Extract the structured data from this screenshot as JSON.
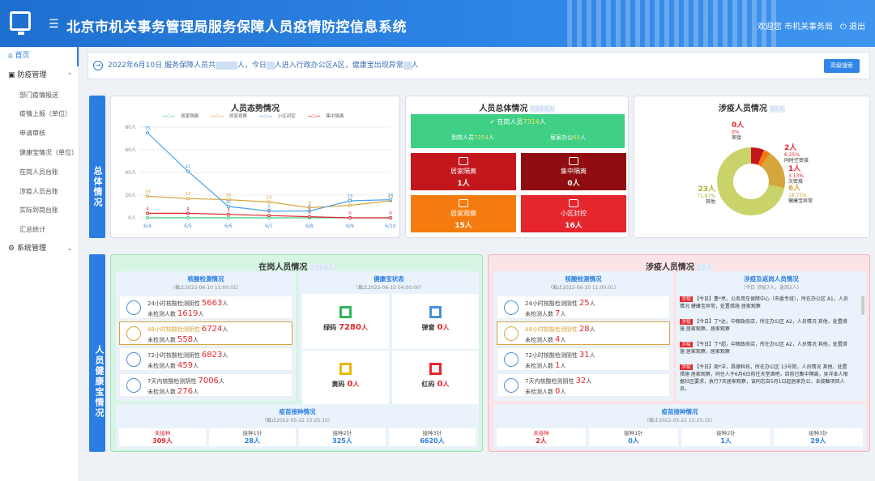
{
  "header": {
    "title": "北京市机关事务管理局服务保障人员疫情防控信息系统",
    "user": "欢迎您 市机关事务局",
    "logout": "退出"
  },
  "sidebar": {
    "items": [
      {
        "label": "首页",
        "top": true
      },
      {
        "label": "防疫管理",
        "top": true
      },
      {
        "label": "部门疫情报送"
      },
      {
        "label": "疫情上报（单位）"
      },
      {
        "label": "申请审核"
      },
      {
        "label": "健康宝情况（单位）"
      },
      {
        "label": "在岗人员台账"
      },
      {
        "label": "涉疫人员台账"
      },
      {
        "label": "实际到岗台账"
      },
      {
        "label": "汇总统计"
      },
      {
        "label": "系统管理",
        "top": true
      }
    ]
  },
  "notice": {
    "prefix": "2022年6月10日 服务保障人员共",
    "mid": "人，今日",
    "mid2": "人进入行政办公区A区，健康宝出现异常",
    "suffix": "人",
    "btn": "高级搜索"
  },
  "section1": {
    "label": "总体情况"
  },
  "section2": {
    "label": "人员健康宝情况"
  },
  "trend": {
    "title": "人员态势情况",
    "legend": [
      "居家隔离",
      "居家观察",
      "小区封控",
      "集中隔离"
    ],
    "colors": [
      "#3fcf85",
      "#d6a53b",
      "#4aa3e8",
      "#e5262c"
    ]
  },
  "chart_data": {
    "type": "line",
    "title": "人员态势情况",
    "categories": [
      "6/4",
      "6/5",
      "6/6",
      "6/7",
      "6/8",
      "6/9",
      "6/10"
    ],
    "ylim": [
      0,
      80
    ],
    "yticks": [
      "80人",
      "60人",
      "40人",
      "20人",
      "0人"
    ],
    "series": [
      {
        "name": "居家隔离",
        "values": [
          0,
          0,
          0,
          0,
          0,
          0,
          0
        ]
      },
      {
        "name": "居家观察",
        "values": [
          19,
          17,
          16,
          14,
          9,
          11,
          15
        ]
      },
      {
        "name": "小区封控",
        "values": [
          75,
          41,
          10,
          6,
          6,
          15,
          16
        ]
      },
      {
        "name": "集中隔离",
        "values": [
          4,
          4,
          3,
          2,
          1,
          0,
          0
        ]
      }
    ]
  },
  "overall": {
    "title": "人员总体情况",
    "onpost": "在岗人员",
    "arrive": "到岗人员",
    "home": "居家办公",
    "unit": "人",
    "boxes": [
      {
        "label": "居家隔离",
        "value": "1人",
        "color": "#c4171d"
      },
      {
        "label": "集中隔离",
        "value": "0人",
        "color": "#8f0d10"
      },
      {
        "label": "居家观察",
        "value": "15人",
        "color": "#f47c0e"
      },
      {
        "label": "小区封控",
        "value": "16人",
        "color": "#e5262c"
      }
    ]
  },
  "epi": {
    "title": "涉疫人员情况",
    "items": [
      {
        "v": "0人",
        "p": "0%",
        "n": "密接"
      },
      {
        "v": "2人",
        "p": "6.25%",
        "n": "同时空密接"
      },
      {
        "v": "1人",
        "p": "3.13%",
        "n": "次密接"
      },
      {
        "v": "6人",
        "p": "18.75%",
        "n": "健康宝异常"
      },
      {
        "v": "23人",
        "p": "71.87%",
        "n": "其他"
      }
    ]
  },
  "onduty": {
    "title": "在岗人员情况",
    "nat_title": "核酸检测情况",
    "nat_date": "（截止2022-06-10 11:00:01）",
    "rows": [
      {
        "a": "24小时核酸检测阴性",
        "av": "5663",
        "b": "未检测人数",
        "bv": "1619"
      },
      {
        "a": "48小时核酸检测阴性",
        "av": "6724",
        "b": "未检测人数",
        "bv": "558"
      },
      {
        "a": "72小时核酸检测阴性",
        "av": "6823",
        "b": "未检测人数",
        "bv": "459"
      },
      {
        "a": "7天内核酸检测阴性",
        "av": "7006",
        "b": "未检测人数",
        "bv": "276"
      }
    ],
    "hb_title": "健康宝状态",
    "hb_date": "（截止2022-06-10 04:00:00）",
    "codes": [
      {
        "n": "绿码",
        "v": "7280",
        "c": "#2fb55e"
      },
      {
        "n": "弹窗",
        "v": "0",
        "c": "#4a90d9"
      },
      {
        "n": "黄码",
        "v": "0",
        "c": "#e6b800"
      },
      {
        "n": "红码",
        "v": "0",
        "c": "#e5262c"
      }
    ],
    "vac_title": "疫苗接种情况",
    "vac_date": "（截止2022-05-22 15:25:15）",
    "vac": [
      {
        "n": "未接种",
        "v": "309人"
      },
      {
        "n": "接种1针",
        "v": "28人"
      },
      {
        "n": "接种2针",
        "v": "325人"
      },
      {
        "n": "接种3针",
        "v": "6620人"
      }
    ]
  },
  "epidut": {
    "title": "涉疫人员情况",
    "nat_title": "核酸检测情况",
    "nat_date": "（截止2022-06-10 11:00:01）",
    "rows": [
      {
        "a": "24小时核酸检测阴性",
        "av": "25",
        "b": "未检测人数",
        "bv": "7"
      },
      {
        "a": "48小时核酸检测阴性",
        "av": "28",
        "b": "未检测人数",
        "bv": "4"
      },
      {
        "a": "72小时核酸检测阴性",
        "av": "31",
        "b": "未检测人数",
        "bv": "1"
      },
      {
        "a": "7天内核酸检测阴性",
        "av": "32",
        "b": "未检测人数",
        "bv": "0"
      }
    ],
    "news_title": "涉疫及返岗人员情况",
    "news_sub": "（今日 涉疫7人，返岗2人）",
    "news": [
      {
        "tag": "涉疫",
        "t": "【今日】董*亮，公务用车保障中心（市委专班），所在办公区 A1，人员情况 健康宝异常，处置措施 居家观察"
      },
      {
        "tag": "涉疫",
        "t": "【今日】丁*达，中粮政府店，所在办公区 A2，人员情况 其他，处置措施 居家观察，居家观察"
      },
      {
        "tag": "涉疫",
        "t": "【今日】丁*超，中粮政府店，所在办公区 A2，人员情况 其他，处置措施 居家观察，居家观察"
      },
      {
        "tag": "涉疫",
        "t": "【今日】周*洋，昌德科技，所在办公区 13号院，人员情况 其他，处置措施 居家观察，同住人于6月6日前往天堂酒吧，目前已集中隔离，吴洋本人根据社区要求，执行7天居家观察，该同志自5月1日起居家办公，未接触项目人员。"
      }
    ],
    "vac_title": "疫苗接种情况",
    "vac_date": "（截止2022-05-22 15:25:15）",
    "vac": [
      {
        "n": "未接种",
        "v": "2人"
      },
      {
        "n": "接种1针",
        "v": "0人"
      },
      {
        "n": "接种2针",
        "v": "1人"
      },
      {
        "n": "接种3针",
        "v": "29人"
      }
    ]
  },
  "unit": "人"
}
